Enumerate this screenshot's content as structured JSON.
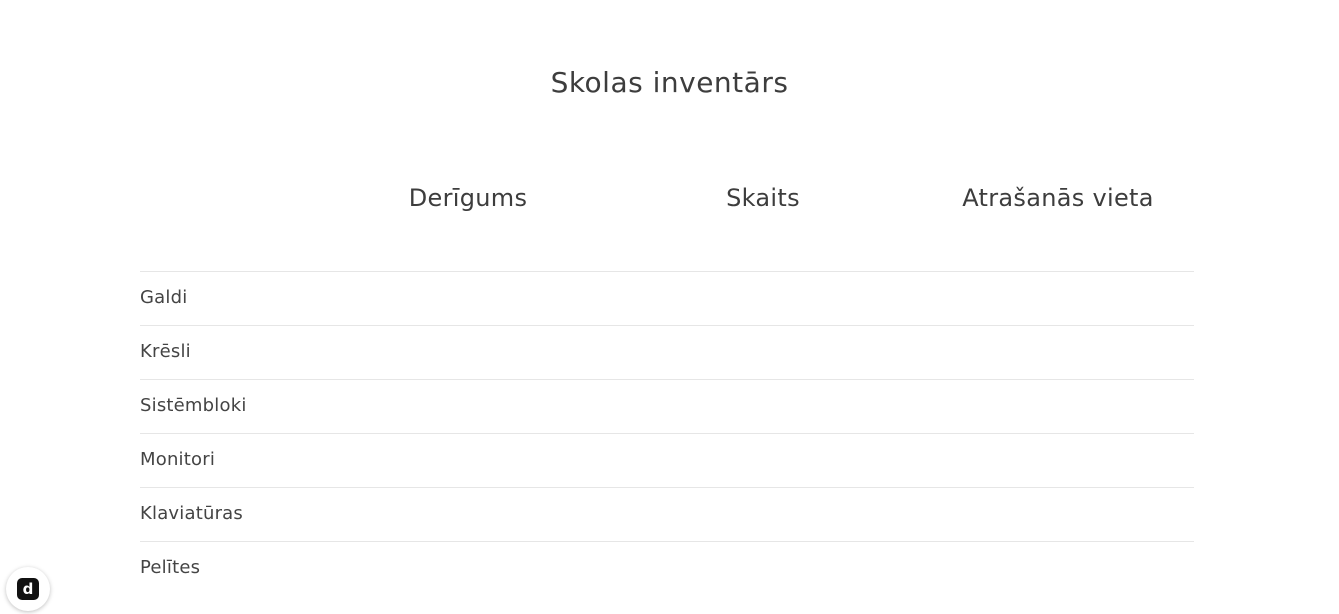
{
  "page": {
    "title": "Skolas inventārs"
  },
  "table": {
    "headers": [
      "Derīgums",
      "Skaits",
      "Atrašanās vieta"
    ],
    "rows": [
      {
        "label": "Galdi"
      },
      {
        "label": "Krēsli"
      },
      {
        "label": "Sistēmbloki"
      },
      {
        "label": "Monitori"
      },
      {
        "label": "Klaviatūras"
      },
      {
        "label": "Pelītes"
      }
    ]
  },
  "badge": {
    "icon": "d-logo-icon",
    "letter": "d"
  },
  "colors": {
    "text": "#3d3d3d",
    "divider": "#e6e6e6",
    "background": "#ffffff"
  }
}
